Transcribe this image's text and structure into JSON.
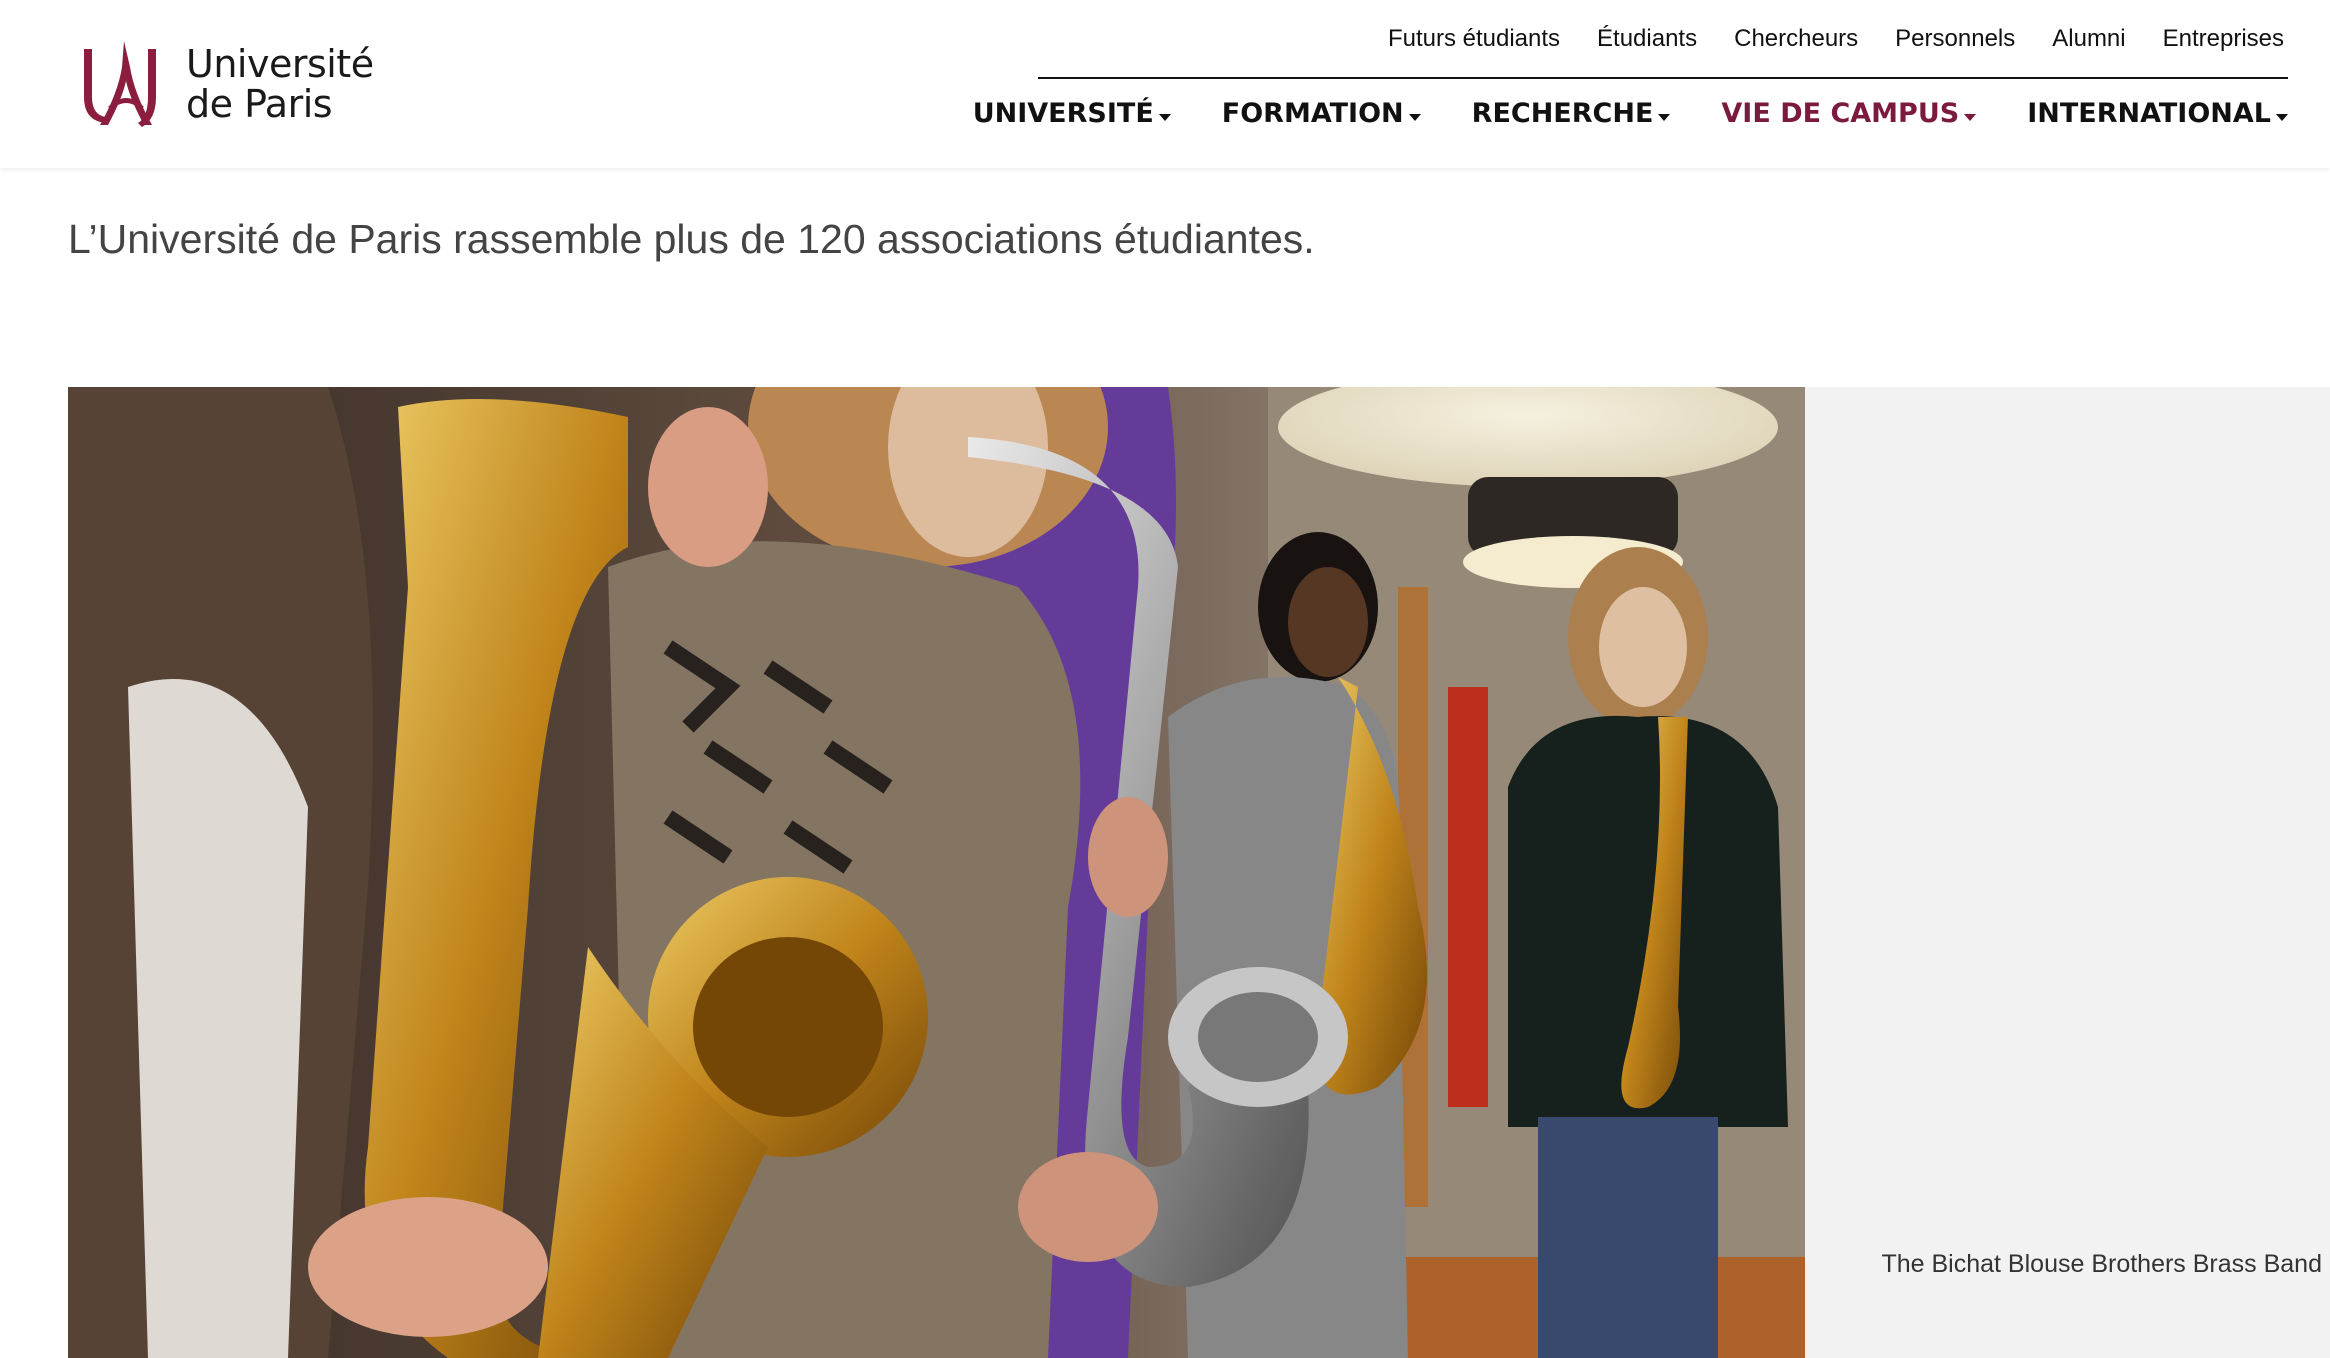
{
  "logo": {
    "line1": "Université",
    "line2": "de Paris",
    "accent_color": "#8b1e3f",
    "icon": "universite-de-paris-logo-icon"
  },
  "utility_nav": [
    "Futurs étudiants",
    "Étudiants",
    "Chercheurs",
    "Personnels",
    "Alumni",
    "Entreprises"
  ],
  "main_nav": [
    {
      "label": "UNIVERSITÉ",
      "active": false
    },
    {
      "label": "FORMATION",
      "active": false
    },
    {
      "label": "RECHERCHE",
      "active": false
    },
    {
      "label": "VIE DE CAMPUS",
      "active": true
    },
    {
      "label": "INTERNATIONAL",
      "active": false
    }
  ],
  "active_color": "#7a1a3e",
  "lead_text": "L’Université de Paris rassemble plus de 120 associations étudiantes.",
  "photo": {
    "subject": "students playing saxophones"
  },
  "caption": "The Bichat Blouse Brothers Brass Band"
}
